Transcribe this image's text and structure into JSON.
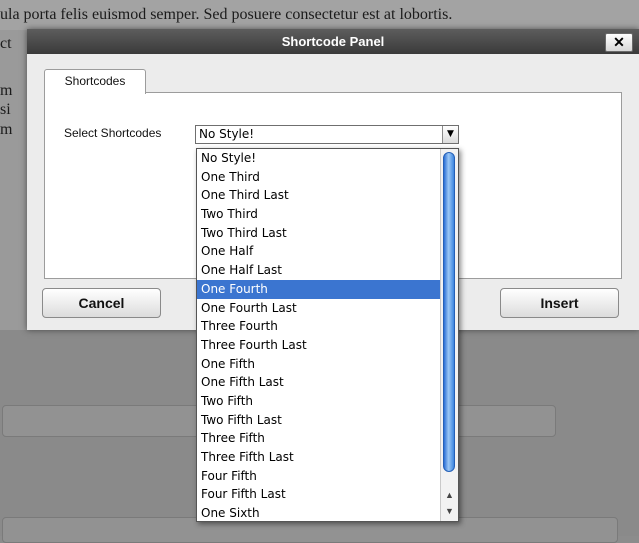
{
  "background": {
    "line1": "ula porta felis euismod semper. Sed posuere consectetur est at lobortis.",
    "fragments": [
      "ct",
      "m",
      "si",
      "m"
    ]
  },
  "dialog": {
    "title": "Shortcode Panel",
    "close_label": "✕",
    "tab_label": "Shortcodes",
    "select_label": "Select Shortcodes",
    "select_value": "No Style!",
    "cancel_label": "Cancel",
    "insert_label": "Insert"
  },
  "dropdown": {
    "selected": "One Fourth",
    "options": [
      "No Style!",
      "One Third",
      "One Third Last",
      "Two Third",
      "Two Third Last",
      "One Half",
      "One Half Last",
      "One Fourth",
      "One Fourth Last",
      "Three Fourth",
      "Three Fourth Last",
      "One Fifth",
      "One Fifth Last",
      "Two Fifth",
      "Two Fifth Last",
      "Three Fifth",
      "Three Fifth Last",
      "Four Fifth",
      "Four Fifth Last",
      "One Sixth"
    ]
  }
}
